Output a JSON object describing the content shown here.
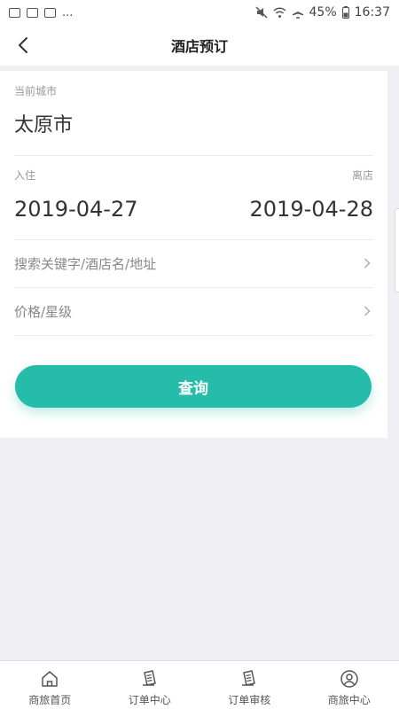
{
  "status_bar": {
    "dots": "...",
    "battery_percent": "45%",
    "time": "16:37"
  },
  "nav": {
    "title": "酒店预订",
    "back_icon": "back-chevron-icon"
  },
  "search_form": {
    "city_label": "当前城市",
    "city_value": "太原市",
    "checkin_label": "入住",
    "checkin_date": "2019-04-27",
    "checkout_label": "离店",
    "checkout_date": "2019-04-28",
    "keyword_placeholder": "搜索关键字/酒店名/地址",
    "price_star_placeholder": "价格/星级",
    "query_button": "查询"
  },
  "colors": {
    "accent": "#25bcaa",
    "background": "#efeff4"
  },
  "tabbar": {
    "items": [
      {
        "label": "商旅首页",
        "icon": "home-icon"
      },
      {
        "label": "订单中心",
        "icon": "document-icon"
      },
      {
        "label": "订单审核",
        "icon": "document-review-icon"
      },
      {
        "label": "商旅中心",
        "icon": "user-circle-icon"
      }
    ]
  }
}
